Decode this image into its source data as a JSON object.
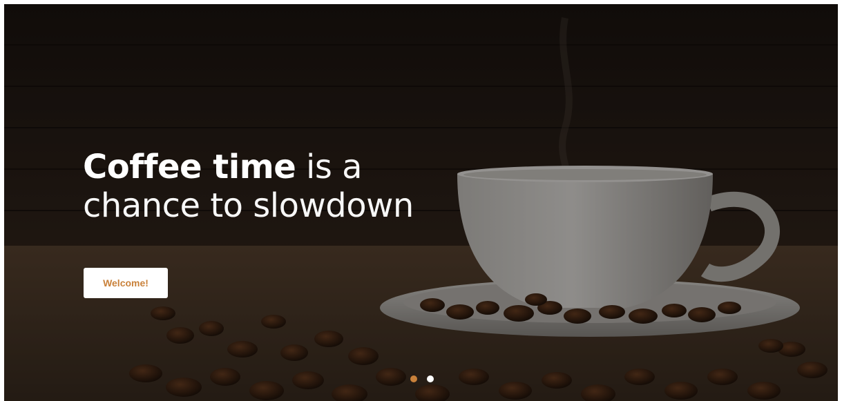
{
  "hero": {
    "headline_bold": "Coffee time",
    "headline_rest_1": " is a",
    "headline_rest_2": "chance to slowdown",
    "cta_label": "Welcome!",
    "image_subject": "white coffee cup on saucer with coffee beans on burlap"
  },
  "carousel": {
    "slide_count": 2,
    "active_index": 0,
    "active_color": "#c9813a",
    "inactive_color": "#ffffff"
  },
  "colors": {
    "accent": "#c9813a",
    "overlay": "#000000"
  }
}
